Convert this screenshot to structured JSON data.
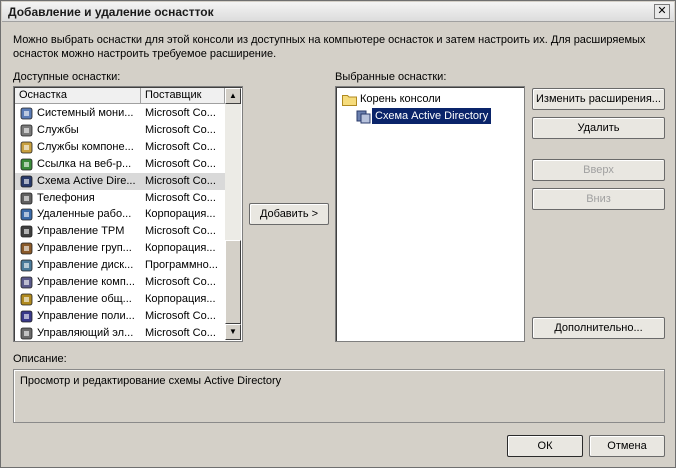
{
  "window": {
    "title": "Добавление и удаление оснастток",
    "close_glyph": "✕"
  },
  "intro": "Можно выбрать оснастки для этой консоли из доступных на компьютере оснасток и затем настроить их. Для расширяемых оснасток можно настроить требуемое расширение.",
  "available": {
    "label": "Доступные оснастки:",
    "columns": {
      "name": "Оснастка",
      "vendor": "Поставщик"
    },
    "rows": [
      {
        "name": "Системный мони...",
        "vendor": "Microsoft Co...",
        "icon": "monitor-gauge-icon"
      },
      {
        "name": "Службы",
        "vendor": "Microsoft Co...",
        "icon": "gears-icon"
      },
      {
        "name": "Службы компоне...",
        "vendor": "Microsoft Co...",
        "icon": "component-services-icon"
      },
      {
        "name": "Ссылка на веб-р...",
        "vendor": "Microsoft Co...",
        "icon": "web-link-icon"
      },
      {
        "name": "Схема Active Dire...",
        "vendor": "Microsoft Co...",
        "icon": "ad-schema-icon",
        "selected": true
      },
      {
        "name": "Телефония",
        "vendor": "Microsoft Co...",
        "icon": "telephony-icon"
      },
      {
        "name": "Удаленные рабо...",
        "vendor": "Корпорация...",
        "icon": "remote-desktops-icon"
      },
      {
        "name": "Управление TPM",
        "vendor": "Microsoft Co...",
        "icon": "tpm-icon"
      },
      {
        "name": "Управление груп...",
        "vendor": "Корпорация...",
        "icon": "group-policy-icon"
      },
      {
        "name": "Управление диск...",
        "vendor": "Программно...",
        "icon": "disk-management-icon"
      },
      {
        "name": "Управление комп...",
        "vendor": "Microsoft Co...",
        "icon": "computer-management-icon"
      },
      {
        "name": "Управление общ...",
        "vendor": "Корпорация...",
        "icon": "shared-folders-icon"
      },
      {
        "name": "Управление поли...",
        "vendor": "Microsoft Co...",
        "icon": "policy-management-icon"
      },
      {
        "name": "Управляющий эл...",
        "vendor": "Microsoft Co...",
        "icon": "control-element-icon"
      }
    ]
  },
  "add_button": "Добавить >",
  "selected": {
    "label": "Выбранные оснастки:",
    "root": "Корень консоли",
    "child": "Схема Active Directory"
  },
  "buttons": {
    "edit_extensions": "Изменить расширения...",
    "remove": "Удалить",
    "up": "Вверх",
    "down": "Вниз",
    "advanced": "Дополнительно...",
    "ok": "ОК",
    "cancel": "Отмена"
  },
  "description": {
    "label": "Описание:",
    "text": "Просмотр и редактирование схемы Active Directory"
  },
  "colors": {
    "selection": "#0a246a",
    "list_selection": "#d9d9d9"
  }
}
